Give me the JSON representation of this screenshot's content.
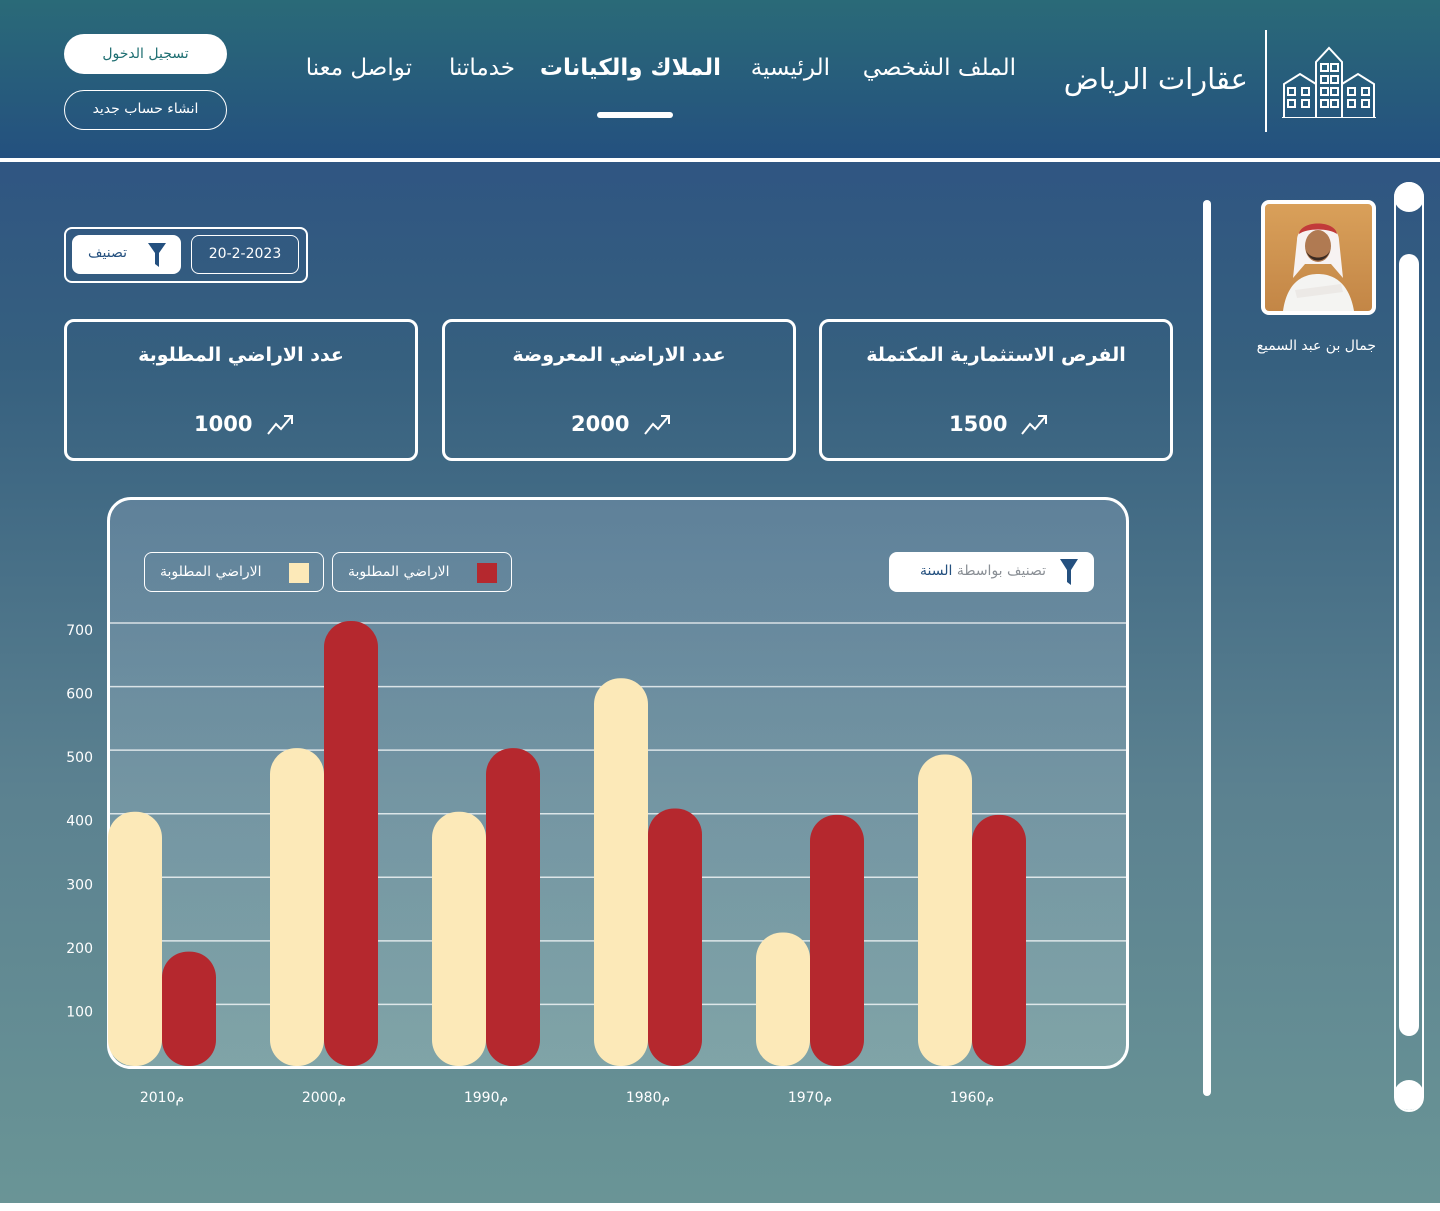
{
  "header": {
    "brand": "عقارات الرياض",
    "nav": [
      {
        "label": "الملف الشخصي",
        "active": false
      },
      {
        "label": "الرئيسية",
        "active": false
      },
      {
        "label": "الملاك والكيانات",
        "active": true
      },
      {
        "label": "خدماتنا",
        "active": false
      },
      {
        "label": "تواصل معنا",
        "active": false
      }
    ],
    "login_label": "تسجيل الدخول",
    "register_label": "انشاء حساب جديد"
  },
  "profile": {
    "name": "جمال بن عبد السميع"
  },
  "filters": {
    "date": "20-2-2023",
    "classify_label": "تصنيف"
  },
  "cards": [
    {
      "title": "الفرص الاستثمارية المكتملة",
      "value": "1500",
      "icon": "trend-up-icon"
    },
    {
      "title": "عدد الاراضي المعروضة",
      "value": "2000",
      "icon": "trend-up-icon"
    },
    {
      "title": "عدد الاراضي المطلوبة",
      "value": "1000",
      "icon": "trend-up-icon"
    }
  ],
  "chart_controls": {
    "sort_prefix": "تصنيف بواسطة",
    "sort_key": "السنة"
  },
  "chart_data": {
    "type": "bar",
    "categories": [
      "2010م",
      "2000م",
      "1990م",
      "1980م",
      "1970م",
      "1960م"
    ],
    "series": [
      {
        "name": "الاراضي المطلوبة",
        "color": "#fce9b8",
        "values": [
          400,
          500,
          400,
          610,
          210,
          490
        ]
      },
      {
        "name": "الاراضي المطلوبة",
        "color": "#b5282e",
        "values": [
          180,
          700,
          500,
          405,
          395,
          395
        ]
      }
    ],
    "yticks": [
      100,
      200,
      300,
      400,
      500,
      600,
      700
    ],
    "ylim": [
      0,
      700
    ],
    "grid": true,
    "legend": "top-left"
  },
  "colors": {
    "accent": "#24507f",
    "bar_light": "#fce9b8",
    "bar_dark": "#b5282e"
  }
}
